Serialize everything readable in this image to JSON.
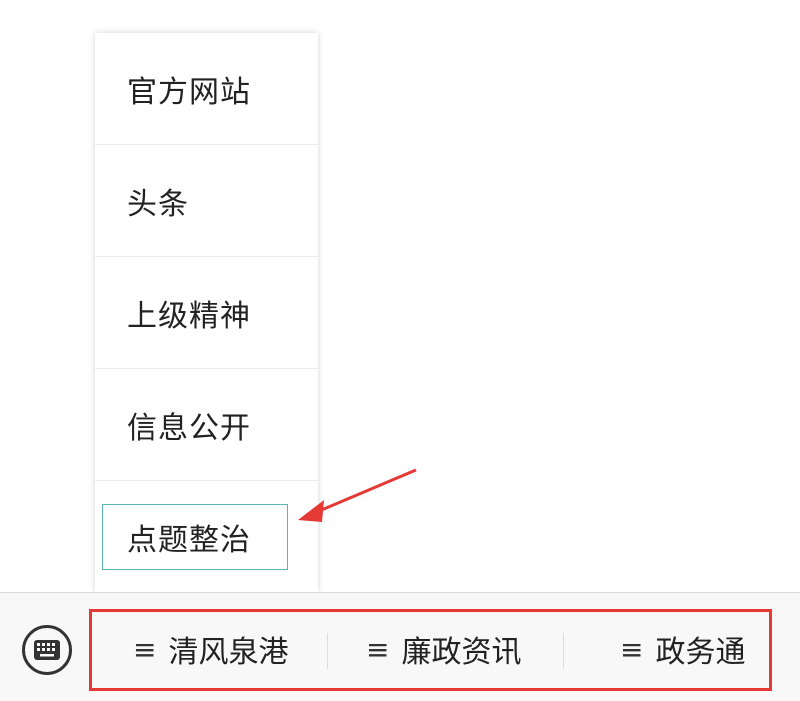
{
  "submenu": {
    "items": [
      {
        "label": "官方网站"
      },
      {
        "label": "头条"
      },
      {
        "label": "上级精神"
      },
      {
        "label": "信息公开"
      },
      {
        "label": "点题整治"
      }
    ]
  },
  "bottom_menu": {
    "keyboard_icon": "keyboard-icon",
    "menu_icon": "hamburger-icon",
    "menu_symbol": "≡",
    "items": [
      {
        "label": "清风泉港"
      },
      {
        "label": "廉政资讯"
      },
      {
        "label": "政务通"
      }
    ]
  },
  "colors": {
    "annotation_red": "#e53935",
    "highlight_teal": "#5ab4b4"
  }
}
